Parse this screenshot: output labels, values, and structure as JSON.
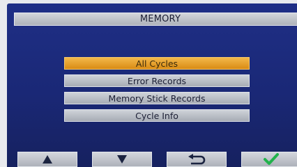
{
  "header": {
    "title": "MEMORY"
  },
  "menu": {
    "items": [
      {
        "label": "All Cycles",
        "selected": true
      },
      {
        "label": "Error Records",
        "selected": false
      },
      {
        "label": "Memory Stick Records",
        "selected": false
      },
      {
        "label": "Cycle Info",
        "selected": false
      }
    ]
  },
  "softkeys": [
    {
      "icon": "up-arrow-icon"
    },
    {
      "icon": "down-arrow-icon"
    },
    {
      "icon": "back-return-icon"
    },
    {
      "icon": "check-icon"
    }
  ],
  "colors": {
    "screen_bg": "#1f2f86",
    "selected_item": "#f0a52a",
    "check_green": "#22b24c"
  }
}
